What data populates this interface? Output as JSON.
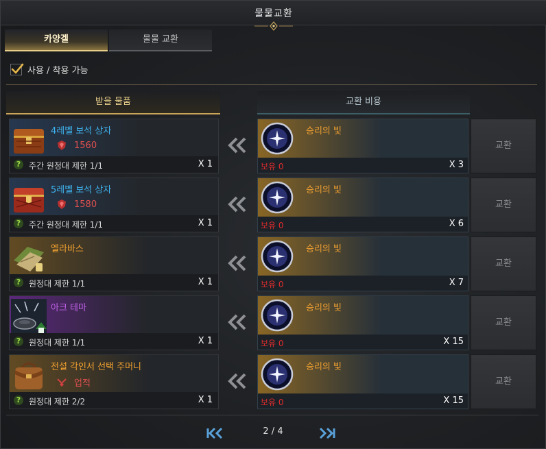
{
  "window": {
    "title": "물물교환"
  },
  "tabs": [
    {
      "label": "카양겔",
      "active": true
    },
    {
      "label": "물물 교환",
      "active": false
    }
  ],
  "filter": {
    "label": "사용 / 착용 가능",
    "checked": true
  },
  "headers": {
    "receive": "받을 물품",
    "cost": "교환 비용"
  },
  "rows": [
    {
      "item": {
        "name": "4레벨 보석 상자",
        "grade": "blue",
        "icon": "jewel-chest-icon",
        "sub_icon": "crest-icon",
        "sub_value": "1560",
        "limit": "주간 원정대 제한 1/1",
        "qty": "X 1"
      },
      "cost": {
        "name": "승리의 빛",
        "icon": "light-of-victory-orb-icon",
        "owned": "보유 0",
        "qty": "X 3"
      },
      "button": "교환"
    },
    {
      "item": {
        "name": "5레벨 보석 상자",
        "grade": "blue",
        "icon": "jewel-chest-icon",
        "sub_icon": "crest-icon",
        "sub_value": "1580",
        "limit": "주간 원정대 제한 1/1",
        "qty": "X 1"
      },
      "cost": {
        "name": "승리의 빛",
        "icon": "light-of-victory-orb-icon",
        "owned": "보유 0",
        "qty": "X 6"
      },
      "button": "교환"
    },
    {
      "item": {
        "name": "엘라바스",
        "grade": "orange",
        "icon": "leaf-bundle-icon",
        "sub_icon": "",
        "sub_value": "",
        "limit": "원정대 제한 1/1",
        "qty": "X 1"
      },
      "cost": {
        "name": "승리의 빛",
        "icon": "light-of-victory-orb-icon",
        "owned": "보유 0",
        "qty": "X 7"
      },
      "button": "교환"
    },
    {
      "item": {
        "name": "아크 테마",
        "grade": "purple",
        "icon": "ark-theme-icon",
        "sub_icon": "",
        "sub_value": "",
        "limit": "원정대 제한 1/1",
        "qty": "X 1"
      },
      "cost": {
        "name": "승리의 빛",
        "icon": "light-of-victory-orb-icon",
        "owned": "보유 0",
        "qty": "X 15"
      },
      "button": "교환"
    },
    {
      "item": {
        "name": "전설 각인서 선택 주머니",
        "grade": "orange",
        "icon": "satchel-icon",
        "sub_icon": "achievement-icon",
        "sub_value": "업적",
        "limit": "원정대 제한 2/2",
        "qty": "X 1"
      },
      "cost": {
        "name": "승리의 빛",
        "icon": "light-of-victory-orb-icon",
        "owned": "보유 0",
        "qty": "X 15"
      },
      "button": "교환"
    }
  ],
  "pagination": {
    "page": "2 / 4"
  },
  "colors": {
    "blue_name": "#3fb4f0",
    "orange_name": "#f0a030",
    "purple_name": "#c060e8",
    "owned_red": "#e02c2c",
    "accent_gold": "#e8cf8a"
  }
}
